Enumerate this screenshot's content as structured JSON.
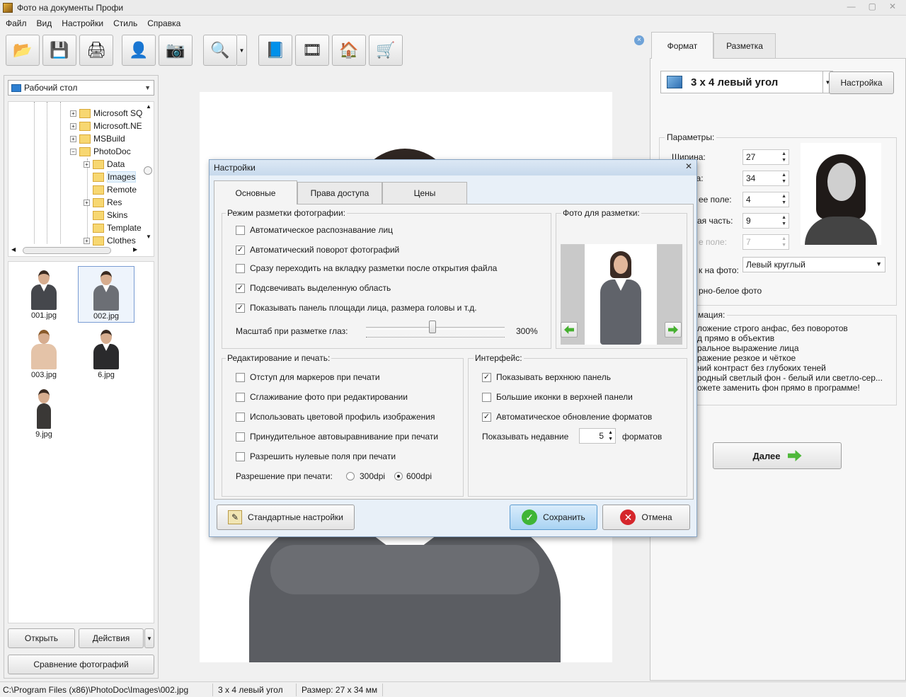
{
  "window": {
    "title": "Фото на документы Профи",
    "controls": [
      "—",
      "▢",
      "✕"
    ]
  },
  "menu": [
    "Файл",
    "Вид",
    "Настройки",
    "Стиль",
    "Справка"
  ],
  "toolbar": {
    "buttons": [
      {
        "name": "open-folder-icon",
        "glyph": "📂"
      },
      {
        "name": "save-icon",
        "glyph": "💾"
      },
      {
        "name": "print-icon",
        "glyph": "🖨"
      },
      {
        "name": "user-icon",
        "glyph": "👤"
      },
      {
        "name": "camera-icon",
        "glyph": "📷"
      },
      {
        "name": "zoom-photo-icon",
        "glyph": "🔍"
      },
      {
        "name": "help-book-icon",
        "glyph": "📘"
      },
      {
        "name": "video-reel-icon",
        "glyph": "🎞"
      },
      {
        "name": "home-icon",
        "glyph": "🏠"
      },
      {
        "name": "cart-icon",
        "glyph": "🛒"
      }
    ],
    "close_glyph": "×"
  },
  "left": {
    "folder_combo": "Рабочий стол",
    "tree": [
      {
        "label": "Microsoft SQ",
        "expander": "+"
      },
      {
        "label": "Microsoft.NE",
        "expander": "+"
      },
      {
        "label": "MSBuild",
        "expander": "+"
      },
      {
        "label": "PhotoDoc",
        "expander": "−"
      },
      {
        "label": "Data",
        "expander": "+"
      },
      {
        "label": "Images",
        "expander": ""
      },
      {
        "label": "Remote",
        "expander": ""
      },
      {
        "label": "Res",
        "expander": "+"
      },
      {
        "label": "Skins",
        "expander": ""
      },
      {
        "label": "Template",
        "expander": ""
      },
      {
        "label": "Clothes",
        "expander": "+"
      }
    ],
    "thumbnails": [
      {
        "name": "001.jpg"
      },
      {
        "name": "002.jpg"
      },
      {
        "name": "003.jpg"
      },
      {
        "name": "6.jpg"
      },
      {
        "name": "9.jpg"
      }
    ],
    "open_btn": "Открыть",
    "actions_btn": "Действия",
    "compare_btn": "Сравнение фотографий"
  },
  "right": {
    "tabs": [
      "Формат",
      "Разметка"
    ],
    "format_name": "3 x 4 левый угол",
    "setup_btn": "Настройка",
    "params_title": "Параметры:",
    "fields": [
      {
        "label": "Ширина:",
        "value": "27"
      },
      {
        "label": "Высота:",
        "value": "34"
      },
      {
        "label": "ее поле:",
        "value": "4"
      },
      {
        "label": "ая часть:",
        "value": "9"
      },
      {
        "label": "е поле:",
        "value": "7"
      }
    ],
    "corner_label": "к на фото:",
    "corner_value": "Левый круглый",
    "bw_label": "рно-белое фото",
    "info_title": "мация:",
    "info_lines": [
      "ложение строго анфас, без поворотов",
      "д прямо в объектив",
      "ральное выражение лица",
      "ражение резкое и чёткое",
      "ний контраст без глубоких теней",
      "родный светлый фон - белый или светло-сер...",
      "ожете заменить фон прямо в программе!"
    ],
    "next_btn": "Далее"
  },
  "dialog": {
    "title": "Настройки",
    "tabs": [
      "Основные",
      "Права доступа",
      "Цены"
    ],
    "markup_group": "Режим разметки фотографии:",
    "markup_options": [
      {
        "label": "Автоматическое распознавание лиц",
        "checked": ""
      },
      {
        "label": "Автоматический поворот фотографий",
        "checked": "✓"
      },
      {
        "label": "Сразу переходить на вкладку разметки после открытия файла",
        "checked": ""
      },
      {
        "label": "Подсвечивать выделенную область",
        "checked": "✓"
      },
      {
        "label": "Показывать панель площади лица, размера головы и т.д.",
        "checked": "✓"
      }
    ],
    "eye_scale_label": "Масштаб при разметке глаз:",
    "eye_scale_value": "300%",
    "eye_scale_position": 0.48,
    "photo_group": "Фото для разметки:",
    "edit_group": "Редактирование и печать:",
    "edit_options": [
      {
        "label": "Отступ для маркеров при печати",
        "checked": ""
      },
      {
        "label": "Сглаживание фото при редактировании",
        "checked": ""
      },
      {
        "label": "Использовать цветовой профиль изображения",
        "checked": ""
      },
      {
        "label": "Принудительное автовыравнивание при печати",
        "checked": ""
      },
      {
        "label": "Разрешить нулевые поля при печати",
        "checked": ""
      }
    ],
    "dpi_label": "Разрешение при печати:",
    "dpi_options": [
      {
        "label": "300dpi",
        "selected": false
      },
      {
        "label": "600dpi",
        "selected": true
      }
    ],
    "ui_group": "Интерфейс:",
    "ui_options": [
      {
        "label": "Показывать верхнюю панель",
        "checked": "✓"
      },
      {
        "label": "Большие иконки в верхней панели",
        "checked": ""
      },
      {
        "label": "Автоматическое обновление форматов",
        "checked": "✓"
      }
    ],
    "recent_label": "Показывать недавние",
    "recent_value": "5",
    "recent_suffix": "форматов",
    "defaults_btn": "Стандартные настройки",
    "save_btn": "Сохранить",
    "cancel_btn": "Отмена"
  },
  "status": {
    "path": "C:\\Program Files (x86)\\PhotoDoc\\Images\\002.jpg",
    "format": "3 x 4 левый угол",
    "size": "Размер: 27 x 34 мм"
  },
  "colors": {
    "accent": "#5b9bd0",
    "dialog_bg": "#e8f0f8",
    "ok_green": "#3fb536",
    "cancel_red": "#d5262b"
  }
}
